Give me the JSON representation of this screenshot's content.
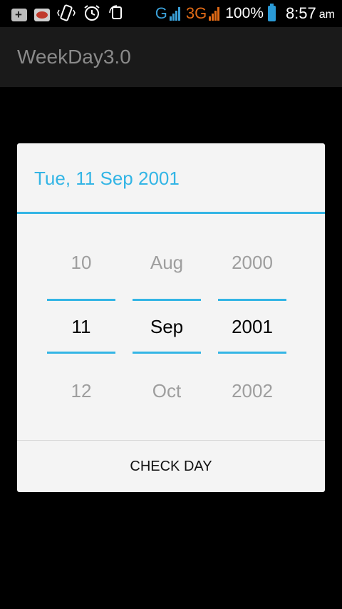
{
  "status_bar": {
    "network_2g": "G",
    "network_3g": "3G",
    "battery_percent": "100%",
    "time": "8:57",
    "ampm": "am",
    "icons": [
      "notification-plus-icon",
      "lips-app-icon",
      "vibrate-icon",
      "alarm-icon",
      "rotate-icon",
      "signal-icon",
      "battery-icon"
    ]
  },
  "app": {
    "title": "WeekDay3.0"
  },
  "dialog": {
    "header_date": "Tue, 11 Sep 2001",
    "day": {
      "prev": "10",
      "current": "11",
      "next": "12"
    },
    "month": {
      "prev": "Aug",
      "current": "Sep",
      "next": "Oct"
    },
    "year": {
      "prev": "2000",
      "current": "2001",
      "next": "2002"
    },
    "button_label": "CHECK DAY",
    "accent_color": "#33b5e5"
  }
}
